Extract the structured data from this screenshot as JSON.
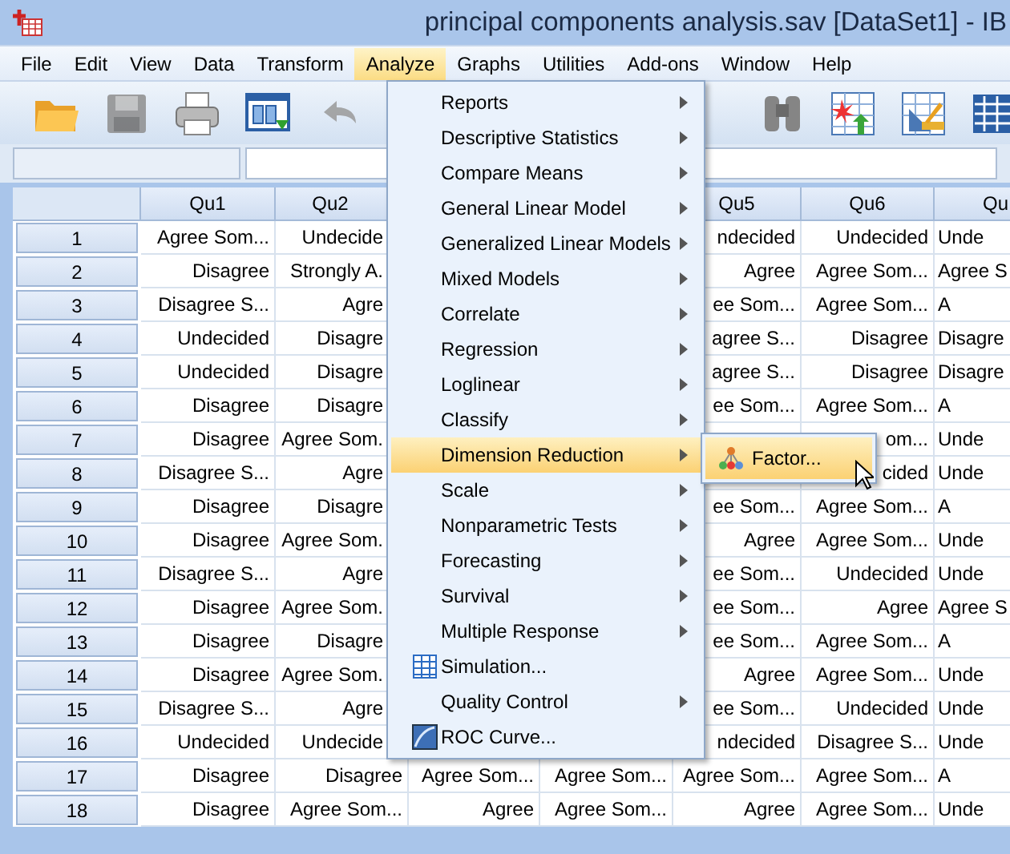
{
  "window": {
    "title": "principal components analysis.sav [DataSet1] - IB"
  },
  "menubar": [
    {
      "label": "File",
      "selected": false
    },
    {
      "label": "Edit",
      "selected": false
    },
    {
      "label": "View",
      "selected": false
    },
    {
      "label": "Data",
      "selected": false
    },
    {
      "label": "Transform",
      "selected": false
    },
    {
      "label": "Analyze",
      "selected": true
    },
    {
      "label": "Graphs",
      "selected": false
    },
    {
      "label": "Utilities",
      "selected": false
    },
    {
      "label": "Add-ons",
      "selected": false
    },
    {
      "label": "Window",
      "selected": false
    },
    {
      "label": "Help",
      "selected": false
    }
  ],
  "toolbar": [
    {
      "kind": "open",
      "disabled": false
    },
    {
      "kind": "save",
      "disabled": true
    },
    {
      "kind": "print",
      "disabled": false
    },
    {
      "kind": "goto-data",
      "disabled": false
    },
    {
      "kind": "undo",
      "disabled": true
    },
    {
      "kind": "find",
      "disabled": false
    },
    {
      "kind": "insert-cases",
      "disabled": false
    },
    {
      "kind": "select-cases",
      "disabled": false
    },
    {
      "kind": "grid",
      "disabled": false
    }
  ],
  "grid": {
    "columns": [
      "Qu1",
      "Qu2",
      null,
      null,
      "Qu5",
      "Qu6",
      "Qu"
    ],
    "rows": [
      {
        "number": "1",
        "cells": [
          "Agree Som...",
          "Undecide",
          null,
          null,
          "ndecided",
          "Undecided",
          "Unde"
        ]
      },
      {
        "number": "2",
        "cells": [
          "Disagree",
          "Strongly A.",
          null,
          null,
          "Agree",
          "Agree Som...",
          "Agree S"
        ]
      },
      {
        "number": "3",
        "cells": [
          "Disagree S...",
          "Agre",
          null,
          null,
          "ee Som...",
          "Agree Som...",
          "A"
        ]
      },
      {
        "number": "4",
        "cells": [
          "Undecided",
          "Disagre",
          null,
          null,
          "agree S...",
          "Disagree",
          "Disagre"
        ]
      },
      {
        "number": "5",
        "cells": [
          "Undecided",
          "Disagre",
          null,
          null,
          "agree S...",
          "Disagree",
          "Disagre"
        ]
      },
      {
        "number": "6",
        "cells": [
          "Disagree",
          "Disagre",
          null,
          null,
          "ee Som...",
          "Agree Som...",
          "A"
        ]
      },
      {
        "number": "7",
        "cells": [
          "Disagree",
          "Agree Som.",
          null,
          null,
          null,
          "om...",
          "Unde"
        ]
      },
      {
        "number": "8",
        "cells": [
          "Disagree S...",
          "Agre",
          null,
          null,
          null,
          "cided",
          "Unde"
        ]
      },
      {
        "number": "9",
        "cells": [
          "Disagree",
          "Disagre",
          null,
          null,
          "ee Som...",
          "Agree Som...",
          "A"
        ]
      },
      {
        "number": "10",
        "cells": [
          "Disagree",
          "Agree Som.",
          null,
          null,
          "Agree",
          "Agree Som...",
          "Unde"
        ]
      },
      {
        "number": "11",
        "cells": [
          "Disagree S...",
          "Agre",
          null,
          null,
          "ee Som...",
          "Undecided",
          "Unde"
        ]
      },
      {
        "number": "12",
        "cells": [
          "Disagree",
          "Agree Som.",
          null,
          null,
          "ee Som...",
          "Agree",
          "Agree S"
        ]
      },
      {
        "number": "13",
        "cells": [
          "Disagree",
          "Disagre",
          null,
          null,
          "ee Som...",
          "Agree Som...",
          "A"
        ]
      },
      {
        "number": "14",
        "cells": [
          "Disagree",
          "Agree Som.",
          null,
          null,
          "Agree",
          "Agree Som...",
          "Unde"
        ]
      },
      {
        "number": "15",
        "cells": [
          "Disagree S...",
          "Agre",
          null,
          null,
          "ee Som...",
          "Undecided",
          "Unde"
        ]
      },
      {
        "number": "16",
        "cells": [
          "Undecided",
          "Undecide",
          null,
          null,
          "ndecided",
          "Disagree S...",
          "Unde"
        ]
      },
      {
        "number": "17",
        "cells": [
          "Disagree",
          "Disagree",
          "Agree Som...",
          "Agree Som...",
          "Agree Som...",
          "Agree Som...",
          "A"
        ]
      },
      {
        "number": "18",
        "cells": [
          "Disagree",
          "Agree Som...",
          "Agree",
          "Agree Som...",
          "Agree",
          "Agree Som...",
          "Unde"
        ]
      }
    ]
  },
  "analyze_menu": {
    "items": [
      {
        "label": "Reports",
        "kind": "submenu",
        "selected": false
      },
      {
        "label": "Descriptive Statistics",
        "kind": "submenu",
        "selected": false
      },
      {
        "label": "Compare Means",
        "kind": "submenu",
        "selected": false
      },
      {
        "label": "General Linear Model",
        "kind": "submenu",
        "selected": false
      },
      {
        "label": "Generalized Linear Models",
        "kind": "submenu",
        "selected": false
      },
      {
        "label": "Mixed Models",
        "kind": "submenu",
        "selected": false
      },
      {
        "label": "Correlate",
        "kind": "submenu",
        "selected": false
      },
      {
        "label": "Regression",
        "kind": "submenu",
        "selected": false
      },
      {
        "label": "Loglinear",
        "kind": "submenu",
        "selected": false
      },
      {
        "label": "Classify",
        "kind": "submenu",
        "selected": false
      },
      {
        "label": "Dimension Reduction",
        "kind": "submenu",
        "selected": true
      },
      {
        "label": "Scale",
        "kind": "submenu",
        "selected": false
      },
      {
        "label": "Nonparametric Tests",
        "kind": "submenu",
        "selected": false
      },
      {
        "label": "Forecasting",
        "kind": "submenu",
        "selected": false
      },
      {
        "label": "Survival",
        "kind": "submenu",
        "selected": false
      },
      {
        "label": "Multiple Response",
        "kind": "submenu",
        "selected": false
      },
      {
        "label": "Simulation...",
        "kind": "simulation",
        "selected": false
      },
      {
        "label": "Quality Control",
        "kind": "submenu",
        "selected": false
      },
      {
        "label": "ROC Curve...",
        "kind": "roc",
        "selected": false
      }
    ]
  },
  "submenu": {
    "items": [
      {
        "label": "Factor...",
        "selected": true
      }
    ]
  }
}
